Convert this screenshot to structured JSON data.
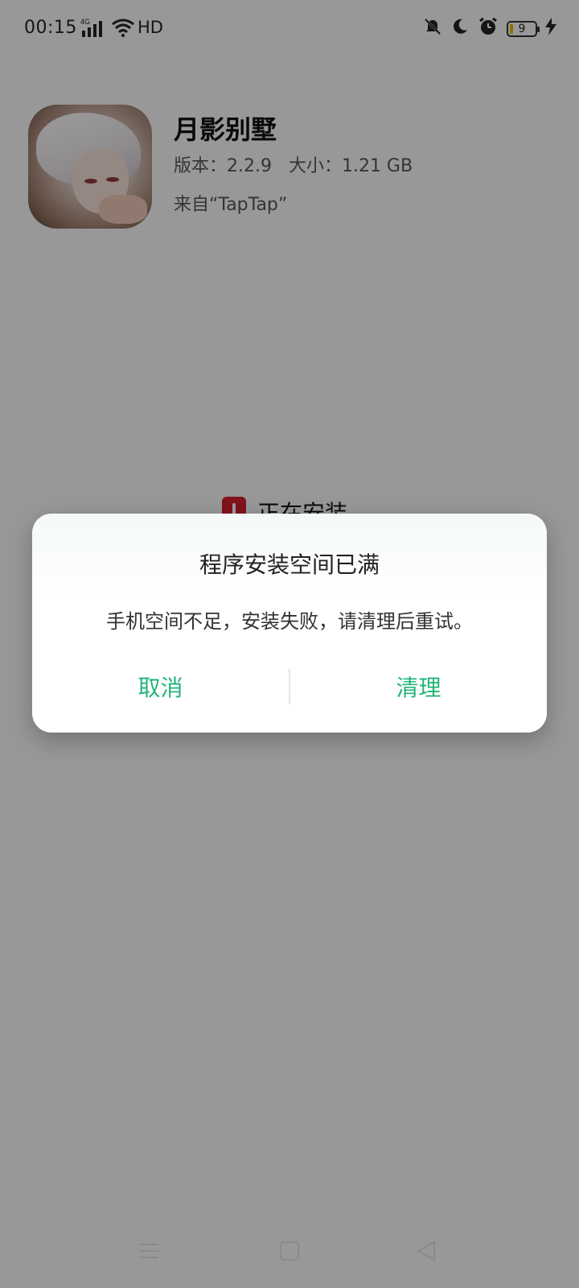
{
  "status_bar": {
    "time": "00:15",
    "network": "4G",
    "wifi": "HD",
    "battery_level": "9",
    "icons": [
      "signal-icon",
      "wifi-icon",
      "bell-off-icon",
      "moon-icon",
      "alarm-icon",
      "battery-icon",
      "charging-icon"
    ]
  },
  "app": {
    "name": "月影别墅",
    "meta": "版本：2.2.9   大小：1.21 GB",
    "source": "来自“TapTap”",
    "icon": "app-avatar-illustration"
  },
  "background": {
    "installing_text": "正在安装"
  },
  "dialog": {
    "title": "程序安装空间已满",
    "message": "手机空间不足，安装失败，请清理后重试。",
    "cancel_label": "取消",
    "clean_label": "清理",
    "accent": "#22b479"
  },
  "nav": {
    "items": [
      "menu-icon",
      "home-icon",
      "back-icon"
    ]
  }
}
